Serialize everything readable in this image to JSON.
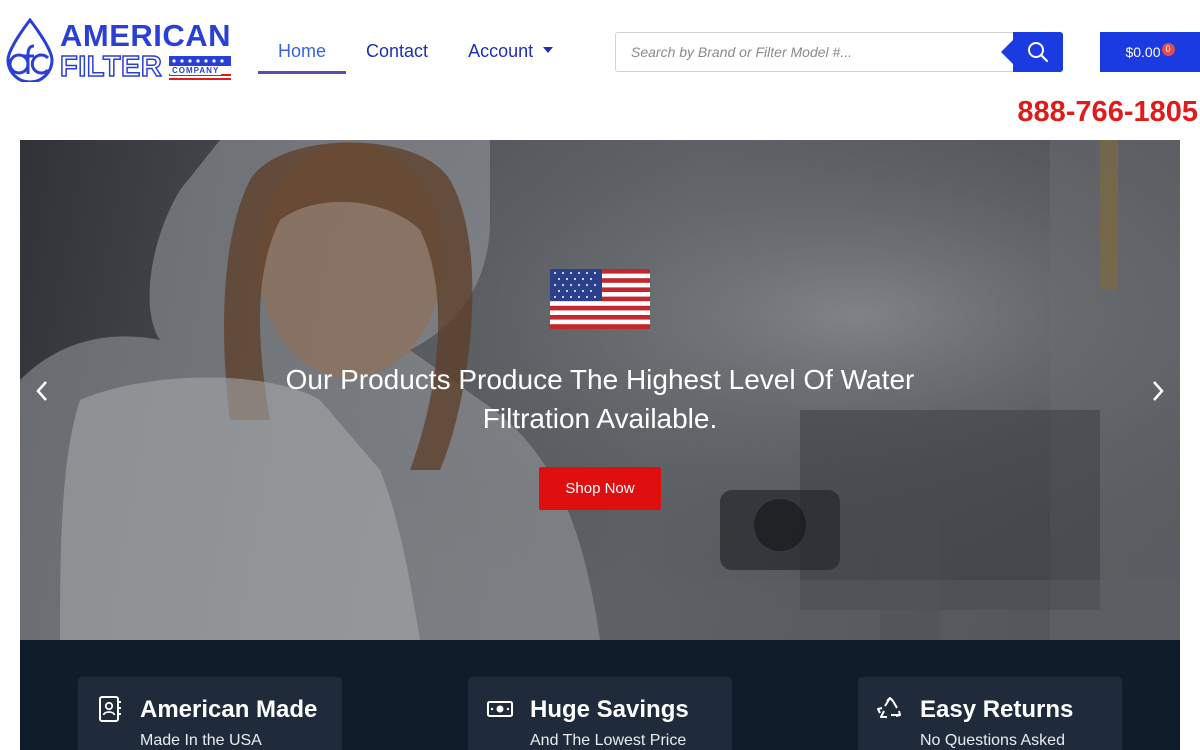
{
  "brand": {
    "line1": "AMERICAN",
    "line2": "FILTER",
    "company": "COMPANY",
    "monogram": "afc",
    "primary_color": "#1a3be0",
    "accent_red": "#e01b1b"
  },
  "nav": {
    "items": [
      {
        "label": "Home",
        "active": true
      },
      {
        "label": "Contact",
        "active": false
      },
      {
        "label": "Account",
        "active": false,
        "dropdown": true
      }
    ]
  },
  "search": {
    "placeholder": "Search by Brand or Filter Model #...",
    "value": "",
    "icon": "search-icon"
  },
  "cart": {
    "total": "$0.00",
    "count": "0"
  },
  "phone": "888-766-1805",
  "hero": {
    "title": "Our Products Produce The Highest Level Of Water Filtration Available.",
    "button_label": "Shop Now",
    "prev_icon": "chevron-left-icon",
    "next_icon": "chevron-right-icon",
    "flag": "us-flag"
  },
  "features": [
    {
      "icon": "contact-book-icon",
      "title": "American Made",
      "subtitle": "Made In the USA"
    },
    {
      "icon": "money-bill-icon",
      "title": "Huge Savings",
      "subtitle": "And The Lowest Price"
    },
    {
      "icon": "recycle-icon",
      "title": "Easy Returns",
      "subtitle": "No Questions Asked"
    }
  ]
}
